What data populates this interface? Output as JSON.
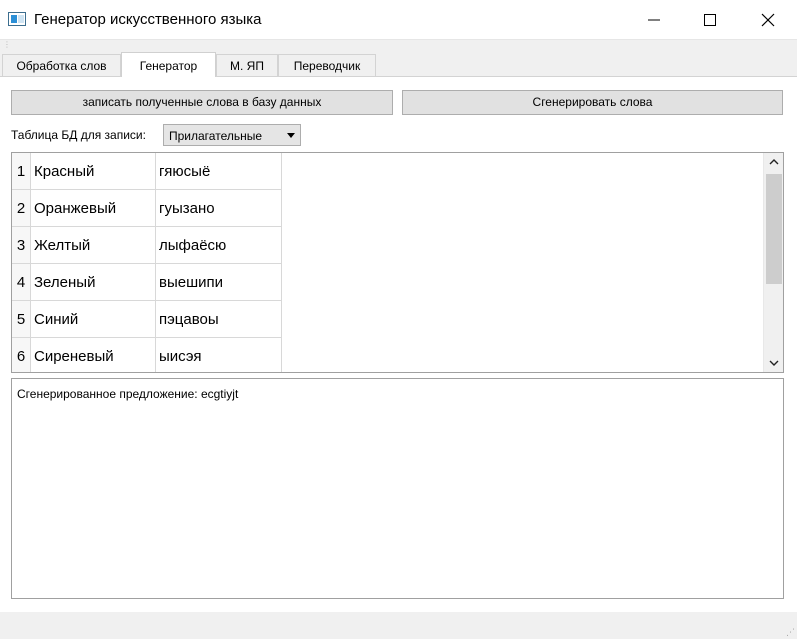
{
  "window": {
    "title": "Генератор искусственного языка",
    "icon": "app-window-icon",
    "controls": [
      "minimize-icon",
      "maximize-icon",
      "close-icon"
    ]
  },
  "tabs": [
    {
      "label": "Обработка слов",
      "active": false
    },
    {
      "label": "Генератор",
      "active": true
    },
    {
      "label": "М. ЯП",
      "active": false
    },
    {
      "label": "Переводчик",
      "active": false
    }
  ],
  "generator": {
    "save_button": "записать полученные слова в базу данных",
    "generate_button": "Сгенерировать слова",
    "table_label": "Таблица БД для записи:",
    "table_select": "Прилагательные"
  },
  "rows": [
    {
      "num": "1",
      "word": "Красный",
      "generated": "гяюсыё"
    },
    {
      "num": "2",
      "word": "Оранжевый",
      "generated": "гуызано"
    },
    {
      "num": "3",
      "word": "Желтый",
      "generated": "лыфаёсю"
    },
    {
      "num": "4",
      "word": "Зеленый",
      "generated": "выешипи"
    },
    {
      "num": "5",
      "word": "Синий",
      "generated": "пэцавоы"
    },
    {
      "num": "6",
      "word": "Сиреневый",
      "generated": "ыисэя"
    }
  ],
  "output": {
    "sentence": "Сгенерированное предложение: ecgtiyjt"
  }
}
